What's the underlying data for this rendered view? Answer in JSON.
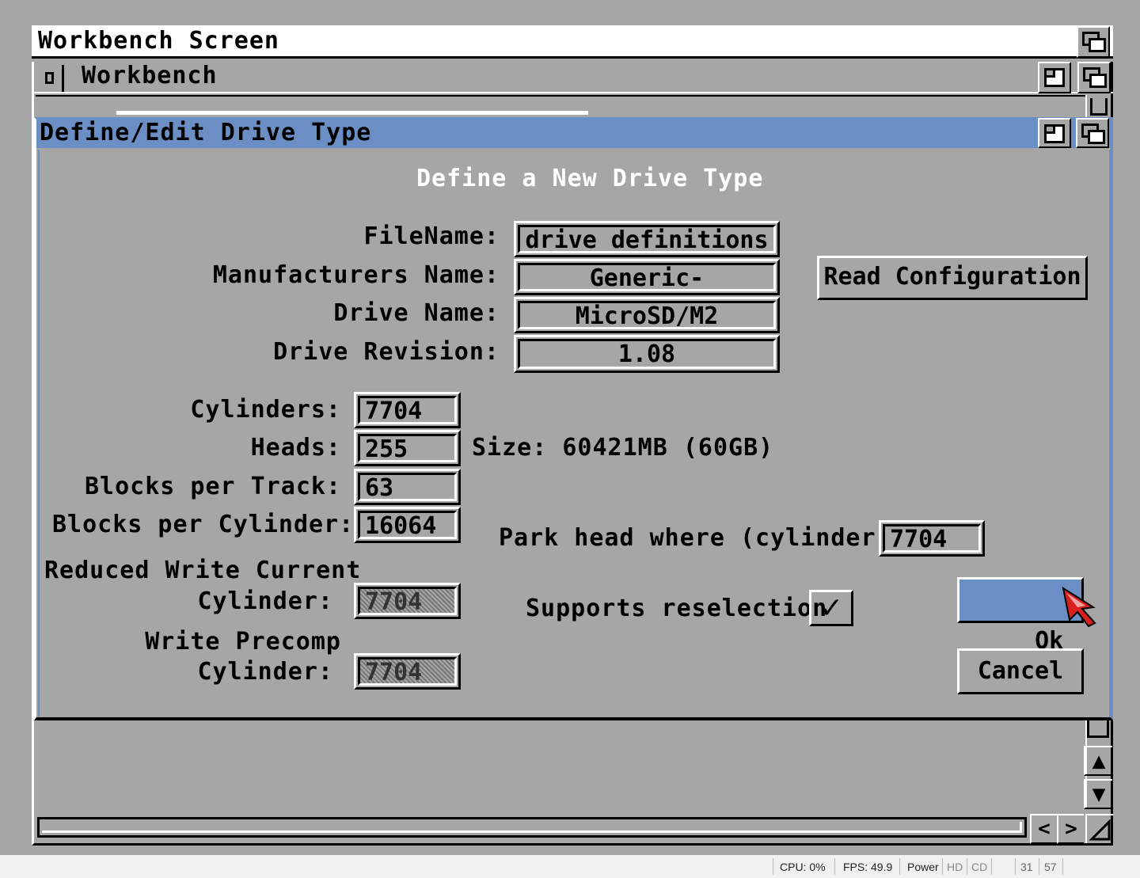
{
  "screen": {
    "title": "Workbench Screen"
  },
  "workbench": {
    "title": "Workbench"
  },
  "dialog": {
    "title": "Define/Edit Drive Type",
    "heading": "Define a New Drive Type",
    "filename": {
      "label": "FileName:",
      "value": "drive definitions"
    },
    "manufacturer": {
      "label": "Manufacturers Name:",
      "value": "Generic-"
    },
    "drive_name": {
      "label": "Drive Name:",
      "value": "MicroSD/M2"
    },
    "drive_revision": {
      "label": "Drive Revision:",
      "value": "1.08"
    },
    "read_config_label": "Read Configuration",
    "cylinders": {
      "label": "Cylinders:",
      "value": "7704"
    },
    "heads": {
      "label": "Heads:",
      "value": "255"
    },
    "size_text": "Size: 60421MB (60GB)",
    "blocks_per_track": {
      "label": "Blocks per Track:",
      "value": "63"
    },
    "blocks_per_cylinder": {
      "label": "Blocks per Cylinder:",
      "value": "16064"
    },
    "park_head": {
      "label": "Park head where (cylinder):",
      "value": "7704"
    },
    "reduced_write": {
      "label_line1": "Reduced Write Current",
      "label_line2": "Cylinder:",
      "value": "7704"
    },
    "supports_reselection": {
      "label": "Supports reselection",
      "checked": true,
      "mark": "✓"
    },
    "write_precomp": {
      "label_line1": "Write Precomp",
      "label_line2": "Cylinder:",
      "value": "7704"
    },
    "ok_label": "Ok",
    "cancel_label": "Cancel"
  },
  "scroll": {
    "up": "▲",
    "down": "▼",
    "left": "<",
    "right": ">"
  },
  "status_bar": {
    "cpu": "CPU: 0%",
    "fps": "FPS: 49.9",
    "power": "Power",
    "hd": "HD",
    "cd": "CD",
    "num1": "31",
    "num2": "57"
  },
  "colors": {
    "accent": "#6b8fc4",
    "background": "#a6a6a6"
  }
}
